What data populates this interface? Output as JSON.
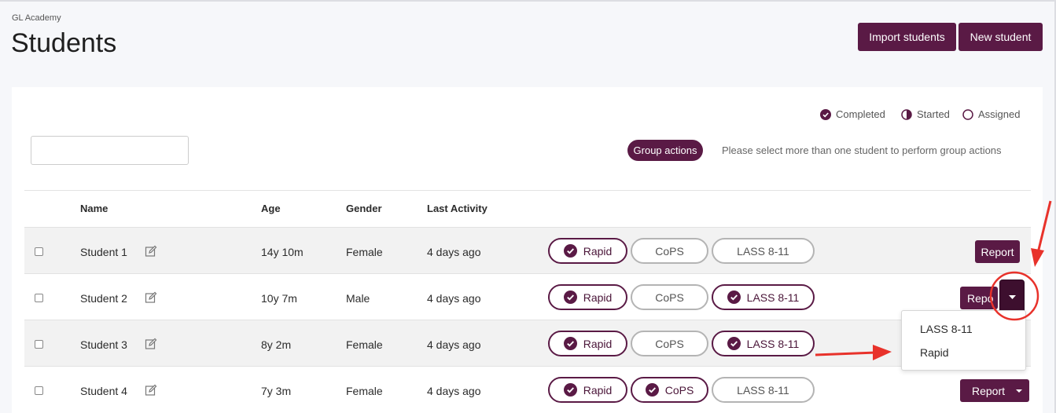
{
  "header": {
    "org": "GL Academy",
    "title": "Students",
    "import_label": "Import students",
    "new_label": "New student"
  },
  "legend": {
    "completed": "Completed",
    "started": "Started",
    "assigned": "Assigned"
  },
  "toolbar": {
    "search_placeholder": "",
    "group_actions": "Group actions",
    "group_note": "Please select more than one student to perform group actions"
  },
  "columns": {
    "name": "Name",
    "age": "Age",
    "gender": "Gender",
    "last_activity": "Last Activity"
  },
  "students": [
    {
      "name": "Student 1",
      "age": "14y 10m",
      "gender": "Female",
      "last": "4 days ago",
      "tests": [
        {
          "label": "Rapid",
          "done": true
        },
        {
          "label": "CoPS",
          "done": false
        },
        {
          "label": "LASS 8-11",
          "done": false
        }
      ],
      "report": "Report"
    },
    {
      "name": "Student 2",
      "age": "10y 7m",
      "gender": "Male",
      "last": "4 days ago",
      "tests": [
        {
          "label": "Rapid",
          "done": true
        },
        {
          "label": "CoPS",
          "done": false
        },
        {
          "label": "LASS 8-11",
          "done": true
        }
      ],
      "report": "Repo"
    },
    {
      "name": "Student 3",
      "age": "8y 2m",
      "gender": "Female",
      "last": "4 days ago",
      "tests": [
        {
          "label": "Rapid",
          "done": true
        },
        {
          "label": "CoPS",
          "done": false
        },
        {
          "label": "LASS 8-11",
          "done": true
        }
      ],
      "report": ""
    },
    {
      "name": "Student 4",
      "age": "7y 3m",
      "gender": "Female",
      "last": "4 days ago",
      "tests": [
        {
          "label": "Rapid",
          "done": true
        },
        {
          "label": "CoPS",
          "done": true
        },
        {
          "label": "LASS 8-11",
          "done": false
        }
      ],
      "report": "Report"
    }
  ],
  "dropdown": {
    "items": [
      "LASS 8-11",
      "Rapid"
    ]
  },
  "colors": {
    "brand": "#5a1a45",
    "annotation": "#e8322b"
  }
}
